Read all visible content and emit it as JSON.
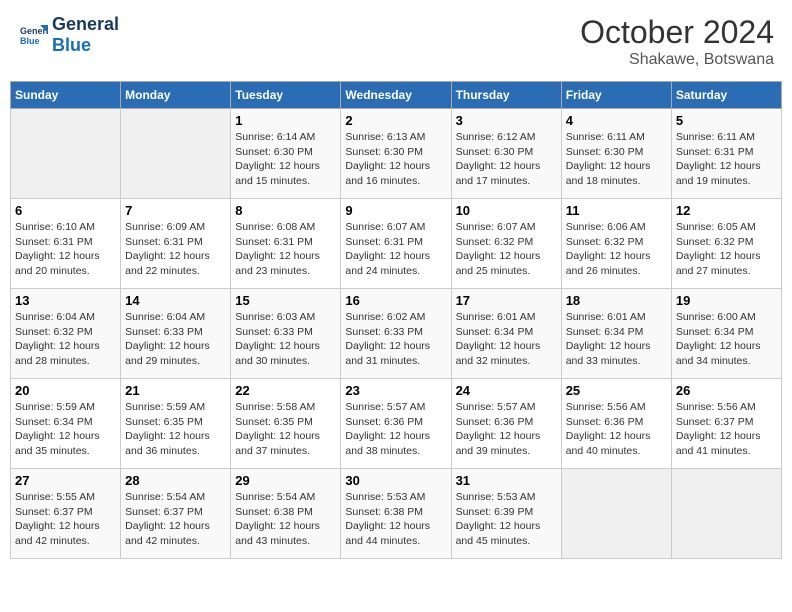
{
  "header": {
    "logo_general": "General",
    "logo_blue": "Blue",
    "month_title": "October 2024",
    "location": "Shakawe, Botswana"
  },
  "weekdays": [
    "Sunday",
    "Monday",
    "Tuesday",
    "Wednesday",
    "Thursday",
    "Friday",
    "Saturday"
  ],
  "weeks": [
    [
      {
        "day": "",
        "sunrise": "",
        "sunset": "",
        "daylight": ""
      },
      {
        "day": "",
        "sunrise": "",
        "sunset": "",
        "daylight": ""
      },
      {
        "day": "1",
        "sunrise": "Sunrise: 6:14 AM",
        "sunset": "Sunset: 6:30 PM",
        "daylight": "Daylight: 12 hours and 15 minutes."
      },
      {
        "day": "2",
        "sunrise": "Sunrise: 6:13 AM",
        "sunset": "Sunset: 6:30 PM",
        "daylight": "Daylight: 12 hours and 16 minutes."
      },
      {
        "day": "3",
        "sunrise": "Sunrise: 6:12 AM",
        "sunset": "Sunset: 6:30 PM",
        "daylight": "Daylight: 12 hours and 17 minutes."
      },
      {
        "day": "4",
        "sunrise": "Sunrise: 6:11 AM",
        "sunset": "Sunset: 6:30 PM",
        "daylight": "Daylight: 12 hours and 18 minutes."
      },
      {
        "day": "5",
        "sunrise": "Sunrise: 6:11 AM",
        "sunset": "Sunset: 6:31 PM",
        "daylight": "Daylight: 12 hours and 19 minutes."
      }
    ],
    [
      {
        "day": "6",
        "sunrise": "Sunrise: 6:10 AM",
        "sunset": "Sunset: 6:31 PM",
        "daylight": "Daylight: 12 hours and 20 minutes."
      },
      {
        "day": "7",
        "sunrise": "Sunrise: 6:09 AM",
        "sunset": "Sunset: 6:31 PM",
        "daylight": "Daylight: 12 hours and 22 minutes."
      },
      {
        "day": "8",
        "sunrise": "Sunrise: 6:08 AM",
        "sunset": "Sunset: 6:31 PM",
        "daylight": "Daylight: 12 hours and 23 minutes."
      },
      {
        "day": "9",
        "sunrise": "Sunrise: 6:07 AM",
        "sunset": "Sunset: 6:31 PM",
        "daylight": "Daylight: 12 hours and 24 minutes."
      },
      {
        "day": "10",
        "sunrise": "Sunrise: 6:07 AM",
        "sunset": "Sunset: 6:32 PM",
        "daylight": "Daylight: 12 hours and 25 minutes."
      },
      {
        "day": "11",
        "sunrise": "Sunrise: 6:06 AM",
        "sunset": "Sunset: 6:32 PM",
        "daylight": "Daylight: 12 hours and 26 minutes."
      },
      {
        "day": "12",
        "sunrise": "Sunrise: 6:05 AM",
        "sunset": "Sunset: 6:32 PM",
        "daylight": "Daylight: 12 hours and 27 minutes."
      }
    ],
    [
      {
        "day": "13",
        "sunrise": "Sunrise: 6:04 AM",
        "sunset": "Sunset: 6:32 PM",
        "daylight": "Daylight: 12 hours and 28 minutes."
      },
      {
        "day": "14",
        "sunrise": "Sunrise: 6:04 AM",
        "sunset": "Sunset: 6:33 PM",
        "daylight": "Daylight: 12 hours and 29 minutes."
      },
      {
        "day": "15",
        "sunrise": "Sunrise: 6:03 AM",
        "sunset": "Sunset: 6:33 PM",
        "daylight": "Daylight: 12 hours and 30 minutes."
      },
      {
        "day": "16",
        "sunrise": "Sunrise: 6:02 AM",
        "sunset": "Sunset: 6:33 PM",
        "daylight": "Daylight: 12 hours and 31 minutes."
      },
      {
        "day": "17",
        "sunrise": "Sunrise: 6:01 AM",
        "sunset": "Sunset: 6:34 PM",
        "daylight": "Daylight: 12 hours and 32 minutes."
      },
      {
        "day": "18",
        "sunrise": "Sunrise: 6:01 AM",
        "sunset": "Sunset: 6:34 PM",
        "daylight": "Daylight: 12 hours and 33 minutes."
      },
      {
        "day": "19",
        "sunrise": "Sunrise: 6:00 AM",
        "sunset": "Sunset: 6:34 PM",
        "daylight": "Daylight: 12 hours and 34 minutes."
      }
    ],
    [
      {
        "day": "20",
        "sunrise": "Sunrise: 5:59 AM",
        "sunset": "Sunset: 6:34 PM",
        "daylight": "Daylight: 12 hours and 35 minutes."
      },
      {
        "day": "21",
        "sunrise": "Sunrise: 5:59 AM",
        "sunset": "Sunset: 6:35 PM",
        "daylight": "Daylight: 12 hours and 36 minutes."
      },
      {
        "day": "22",
        "sunrise": "Sunrise: 5:58 AM",
        "sunset": "Sunset: 6:35 PM",
        "daylight": "Daylight: 12 hours and 37 minutes."
      },
      {
        "day": "23",
        "sunrise": "Sunrise: 5:57 AM",
        "sunset": "Sunset: 6:36 PM",
        "daylight": "Daylight: 12 hours and 38 minutes."
      },
      {
        "day": "24",
        "sunrise": "Sunrise: 5:57 AM",
        "sunset": "Sunset: 6:36 PM",
        "daylight": "Daylight: 12 hours and 39 minutes."
      },
      {
        "day": "25",
        "sunrise": "Sunrise: 5:56 AM",
        "sunset": "Sunset: 6:36 PM",
        "daylight": "Daylight: 12 hours and 40 minutes."
      },
      {
        "day": "26",
        "sunrise": "Sunrise: 5:56 AM",
        "sunset": "Sunset: 6:37 PM",
        "daylight": "Daylight: 12 hours and 41 minutes."
      }
    ],
    [
      {
        "day": "27",
        "sunrise": "Sunrise: 5:55 AM",
        "sunset": "Sunset: 6:37 PM",
        "daylight": "Daylight: 12 hours and 42 minutes."
      },
      {
        "day": "28",
        "sunrise": "Sunrise: 5:54 AM",
        "sunset": "Sunset: 6:37 PM",
        "daylight": "Daylight: 12 hours and 42 minutes."
      },
      {
        "day": "29",
        "sunrise": "Sunrise: 5:54 AM",
        "sunset": "Sunset: 6:38 PM",
        "daylight": "Daylight: 12 hours and 43 minutes."
      },
      {
        "day": "30",
        "sunrise": "Sunrise: 5:53 AM",
        "sunset": "Sunset: 6:38 PM",
        "daylight": "Daylight: 12 hours and 44 minutes."
      },
      {
        "day": "31",
        "sunrise": "Sunrise: 5:53 AM",
        "sunset": "Sunset: 6:39 PM",
        "daylight": "Daylight: 12 hours and 45 minutes."
      },
      {
        "day": "",
        "sunrise": "",
        "sunset": "",
        "daylight": ""
      },
      {
        "day": "",
        "sunrise": "",
        "sunset": "",
        "daylight": ""
      }
    ]
  ]
}
